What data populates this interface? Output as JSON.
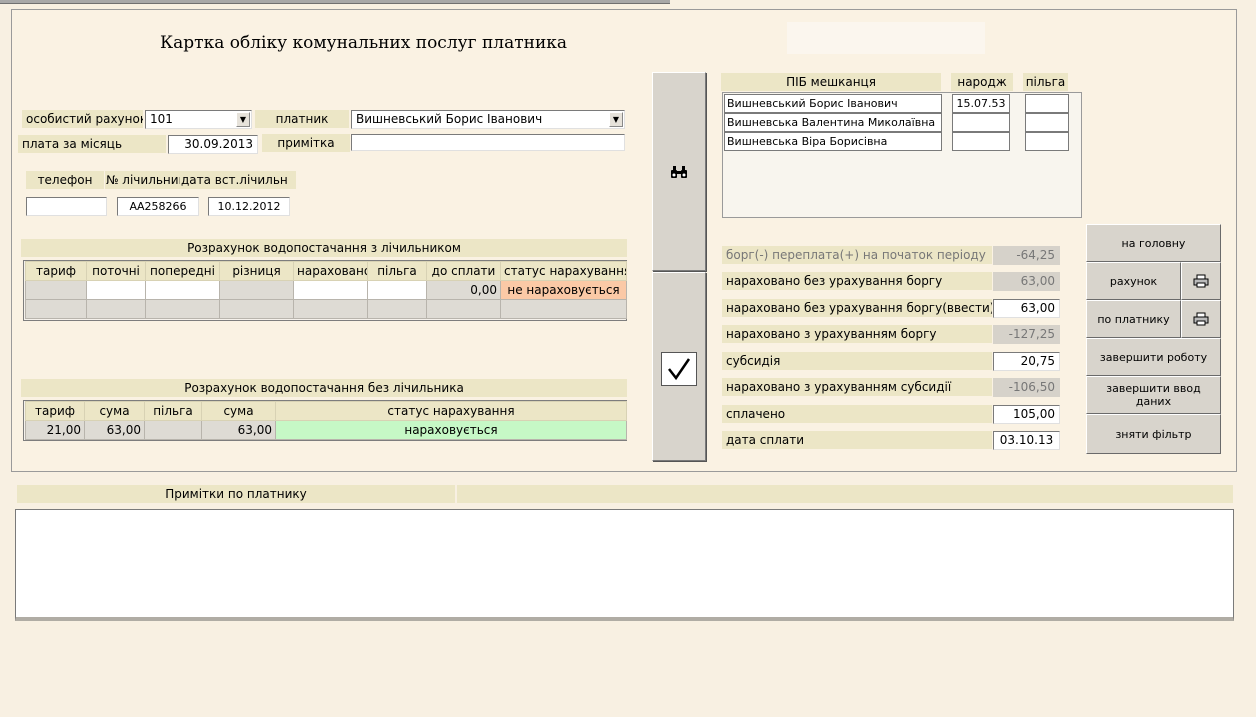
{
  "form": {
    "title": "Картка обліку комунальних послуг платника",
    "account_label": "особистий рахунок",
    "account_value": "101",
    "payer_label": "платник",
    "payer_value": "Вишневський Борис Іванович",
    "monthly_label": "плата за місяць",
    "monthly_value": "30.09.2013",
    "note_label": "примітка",
    "note_value": "",
    "phone_label": "телефон",
    "meter_no_label": "№ лічильника",
    "meter_date_label": "дата вст.лічильн",
    "phone_value": "",
    "meter_no_value": "АА258266",
    "meter_date_value": "10.12.2012"
  },
  "meter_calc": {
    "title": "Розрахунок водопостачання з лічильником",
    "headers": [
      "тариф",
      "поточні",
      "попередні",
      "різниця",
      "нараховано",
      "пільга",
      "до сплати",
      "статус нарахування"
    ],
    "row1": [
      "",
      "",
      "",
      "",
      "",
      "",
      "0,00",
      "не нараховується"
    ]
  },
  "nometer_calc": {
    "title": "Розрахунок водопостачання без лічильника",
    "headers": [
      "тариф",
      "сума",
      "пільга",
      "сума",
      "статус нарахування"
    ],
    "row1": [
      "21,00",
      "63,00",
      "",
      "63,00",
      "нараховується"
    ]
  },
  "residents": {
    "headers": [
      "ПІБ мешканця",
      "народж",
      "пільга"
    ],
    "rows": [
      {
        "name": "Вишневський Борис Іванович",
        "birth": "15.07.53",
        "benefit": ""
      },
      {
        "name": "Вишневська Валентина Миколаївна",
        "birth": "",
        "benefit": ""
      },
      {
        "name": "Вишневська Віра Борисівна",
        "birth": "",
        "benefit": ""
      }
    ]
  },
  "summary": {
    "debt_label": "борг(-) переплата(+) на початок періоду",
    "debt_value": "-64,25",
    "accrued_label": "нараховано без урахування боргу",
    "accrued_value": "63,00",
    "accrued_input_label": "нараховано без урахування боргу(ввести)",
    "accrued_input_value": "63,00",
    "accrued_debt_label": "нараховано з урахуванням боргу",
    "accrued_debt_value": "-127,25",
    "subsidy_label": "субсидія",
    "subsidy_value": "20,75",
    "accrued_subsidy_label": "нараховано з урахуванням субсидії",
    "accrued_subsidy_value": "-106,50",
    "paid_label": "сплачено",
    "paid_value": "105,00",
    "pay_date_label": "дата сплати",
    "pay_date_value": "03.10.13"
  },
  "buttons": {
    "home": "на головну",
    "bill": "рахунок",
    "by_payer": "по платнику",
    "finish_work": "завершити роботу",
    "finish_input": "завершити ввод даних",
    "clear_filter": "зняти фільтр"
  },
  "notes": {
    "label": "Примітки по платнику",
    "text": ""
  },
  "icons": {
    "search": "binoculars-icon",
    "confirm": "checkmark-icon",
    "print": "printer-icon"
  }
}
